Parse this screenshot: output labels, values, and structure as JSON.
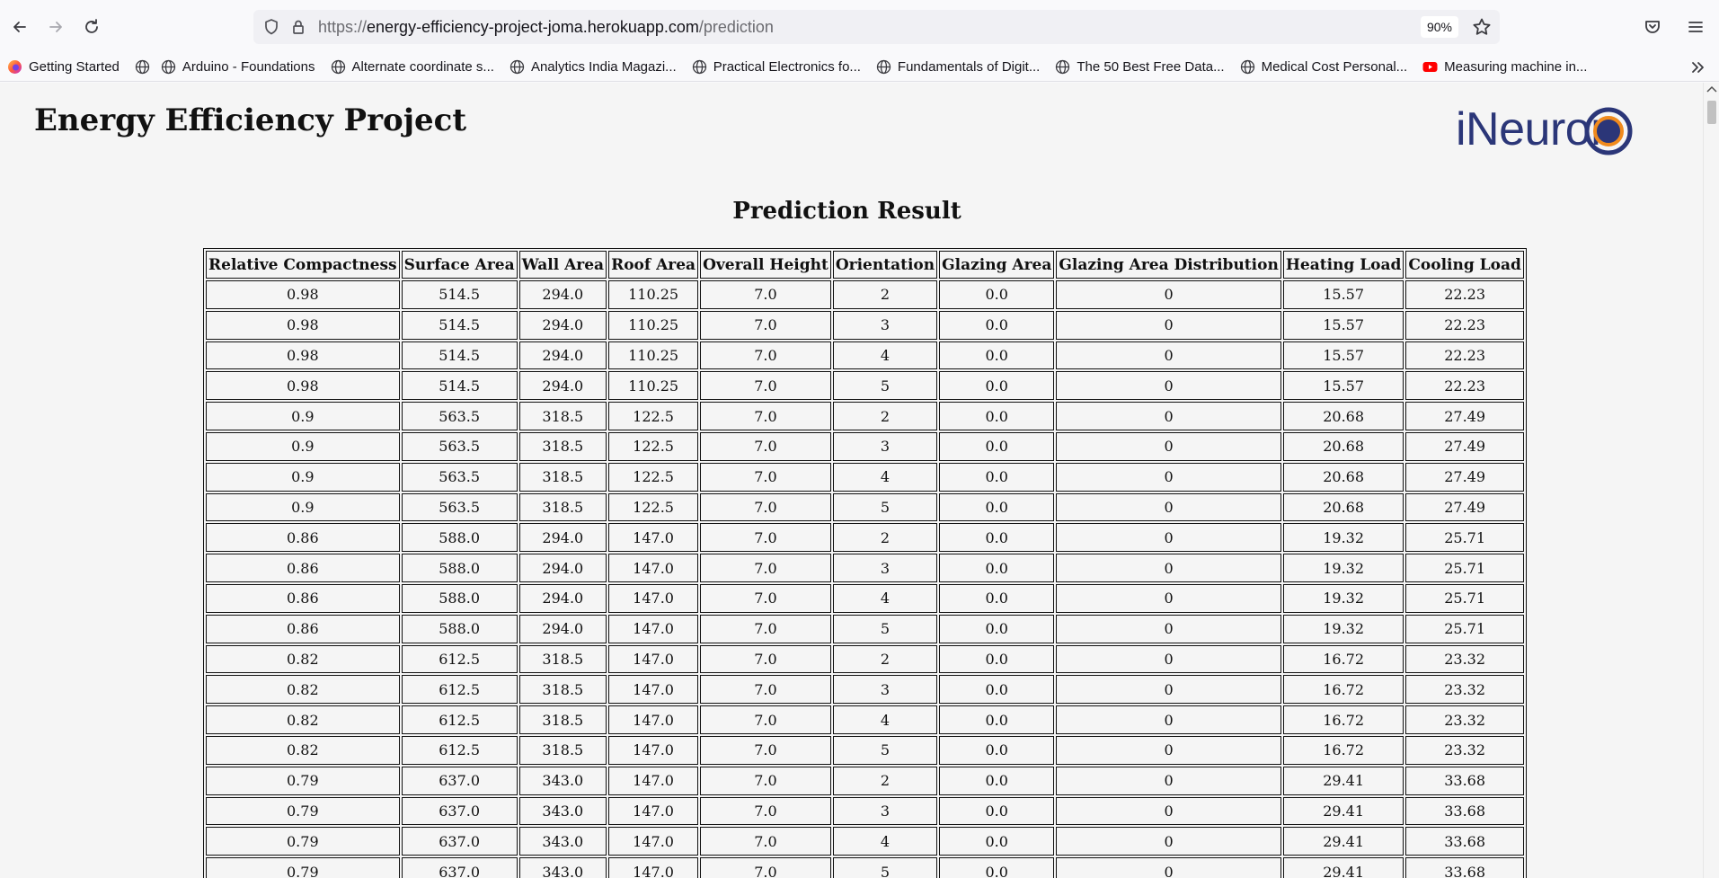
{
  "browser": {
    "url_prefix": "https://",
    "url_host": "energy-efficiency-project-joma.herokuapp.com",
    "url_path": "/prediction",
    "zoom": "90%"
  },
  "bookmarks": [
    {
      "label": "Getting Started",
      "icon": "firefox-icon"
    },
    {
      "label": "Arduino - Foundations",
      "icon": "globe-icon"
    },
    {
      "label": "Alternate coordinate s...",
      "icon": "globe-icon"
    },
    {
      "label": "Analytics India Magazi...",
      "icon": "globe-icon"
    },
    {
      "label": "Practical Electronics fo...",
      "icon": "globe-icon"
    },
    {
      "label": "Fundamentals of Digit...",
      "icon": "globe-icon"
    },
    {
      "label": "The 50 Best Free Data...",
      "icon": "globe-icon"
    },
    {
      "label": "Medical Cost Personal...",
      "icon": "globe-icon"
    },
    {
      "label": "Measuring machine in...",
      "icon": "youtube-icon"
    }
  ],
  "page": {
    "title": "Energy Efficiency Project",
    "logo_text": "iNeuron",
    "result_title": "Prediction Result"
  },
  "colors": {
    "logo_navy": "#2b3678",
    "logo_orange": "#f08a1c"
  },
  "table": {
    "columns": [
      "Relative Compactness",
      "Surface Area",
      "Wall Area",
      "Roof Area",
      "Overall Height",
      "Orientation",
      "Glazing Area",
      "Glazing Area Distribution",
      "Heating Load",
      "Cooling Load"
    ],
    "rows": [
      [
        "0.98",
        "514.5",
        "294.0",
        "110.25",
        "7.0",
        "2",
        "0.0",
        "0",
        "15.57",
        "22.23"
      ],
      [
        "0.98",
        "514.5",
        "294.0",
        "110.25",
        "7.0",
        "3",
        "0.0",
        "0",
        "15.57",
        "22.23"
      ],
      [
        "0.98",
        "514.5",
        "294.0",
        "110.25",
        "7.0",
        "4",
        "0.0",
        "0",
        "15.57",
        "22.23"
      ],
      [
        "0.98",
        "514.5",
        "294.0",
        "110.25",
        "7.0",
        "5",
        "0.0",
        "0",
        "15.57",
        "22.23"
      ],
      [
        "0.9",
        "563.5",
        "318.5",
        "122.5",
        "7.0",
        "2",
        "0.0",
        "0",
        "20.68",
        "27.49"
      ],
      [
        "0.9",
        "563.5",
        "318.5",
        "122.5",
        "7.0",
        "3",
        "0.0",
        "0",
        "20.68",
        "27.49"
      ],
      [
        "0.9",
        "563.5",
        "318.5",
        "122.5",
        "7.0",
        "4",
        "0.0",
        "0",
        "20.68",
        "27.49"
      ],
      [
        "0.9",
        "563.5",
        "318.5",
        "122.5",
        "7.0",
        "5",
        "0.0",
        "0",
        "20.68",
        "27.49"
      ],
      [
        "0.86",
        "588.0",
        "294.0",
        "147.0",
        "7.0",
        "2",
        "0.0",
        "0",
        "19.32",
        "25.71"
      ],
      [
        "0.86",
        "588.0",
        "294.0",
        "147.0",
        "7.0",
        "3",
        "0.0",
        "0",
        "19.32",
        "25.71"
      ],
      [
        "0.86",
        "588.0",
        "294.0",
        "147.0",
        "7.0",
        "4",
        "0.0",
        "0",
        "19.32",
        "25.71"
      ],
      [
        "0.86",
        "588.0",
        "294.0",
        "147.0",
        "7.0",
        "5",
        "0.0",
        "0",
        "19.32",
        "25.71"
      ],
      [
        "0.82",
        "612.5",
        "318.5",
        "147.0",
        "7.0",
        "2",
        "0.0",
        "0",
        "16.72",
        "23.32"
      ],
      [
        "0.82",
        "612.5",
        "318.5",
        "147.0",
        "7.0",
        "3",
        "0.0",
        "0",
        "16.72",
        "23.32"
      ],
      [
        "0.82",
        "612.5",
        "318.5",
        "147.0",
        "7.0",
        "4",
        "0.0",
        "0",
        "16.72",
        "23.32"
      ],
      [
        "0.82",
        "612.5",
        "318.5",
        "147.0",
        "7.0",
        "5",
        "0.0",
        "0",
        "16.72",
        "23.32"
      ],
      [
        "0.79",
        "637.0",
        "343.0",
        "147.0",
        "7.0",
        "2",
        "0.0",
        "0",
        "29.41",
        "33.68"
      ],
      [
        "0.79",
        "637.0",
        "343.0",
        "147.0",
        "7.0",
        "3",
        "0.0",
        "0",
        "29.41",
        "33.68"
      ],
      [
        "0.79",
        "637.0",
        "343.0",
        "147.0",
        "7.0",
        "4",
        "0.0",
        "0",
        "29.41",
        "33.68"
      ],
      [
        "0.79",
        "637.0",
        "343.0",
        "147.0",
        "7.0",
        "5",
        "0.0",
        "0",
        "29.41",
        "33.68"
      ]
    ]
  }
}
